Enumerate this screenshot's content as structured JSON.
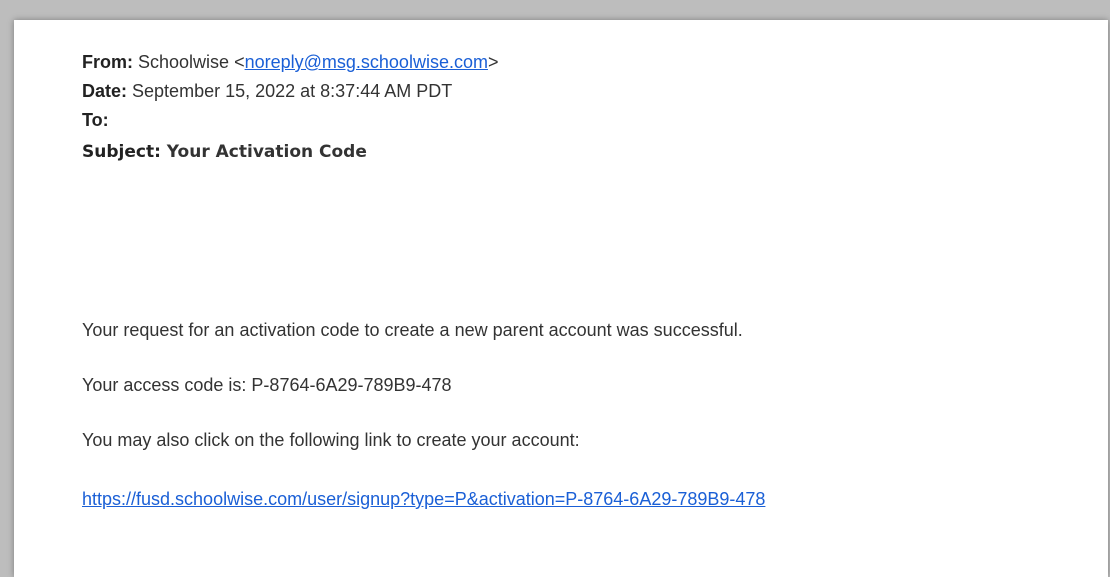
{
  "email": {
    "from_label": "From:",
    "from_name": "Schoolwise",
    "from_open": "<",
    "from_address": "noreply@msg.schoolwise.com",
    "from_close": ">",
    "date_label": "Date:",
    "date_value": "September 15, 2022 at 8:37:44 AM PDT",
    "to_label": "To:",
    "to_value": "",
    "subject_label": "Subject:",
    "subject_value": "Your Activation Code"
  },
  "body": {
    "line1": "Your request for an activation code to create a new parent account was successful.",
    "line2": "Your access code is: P-8764-6A29-789B9-478",
    "line3": "You may also click on the following link to create your account:",
    "link": "https://fusd.schoolwise.com/user/signup?type=P&activation=P-8764-6A29-789B9-478"
  },
  "colors": {
    "link": "#1a5fd6",
    "text": "#333333",
    "frame": "#bdbdbd"
  }
}
